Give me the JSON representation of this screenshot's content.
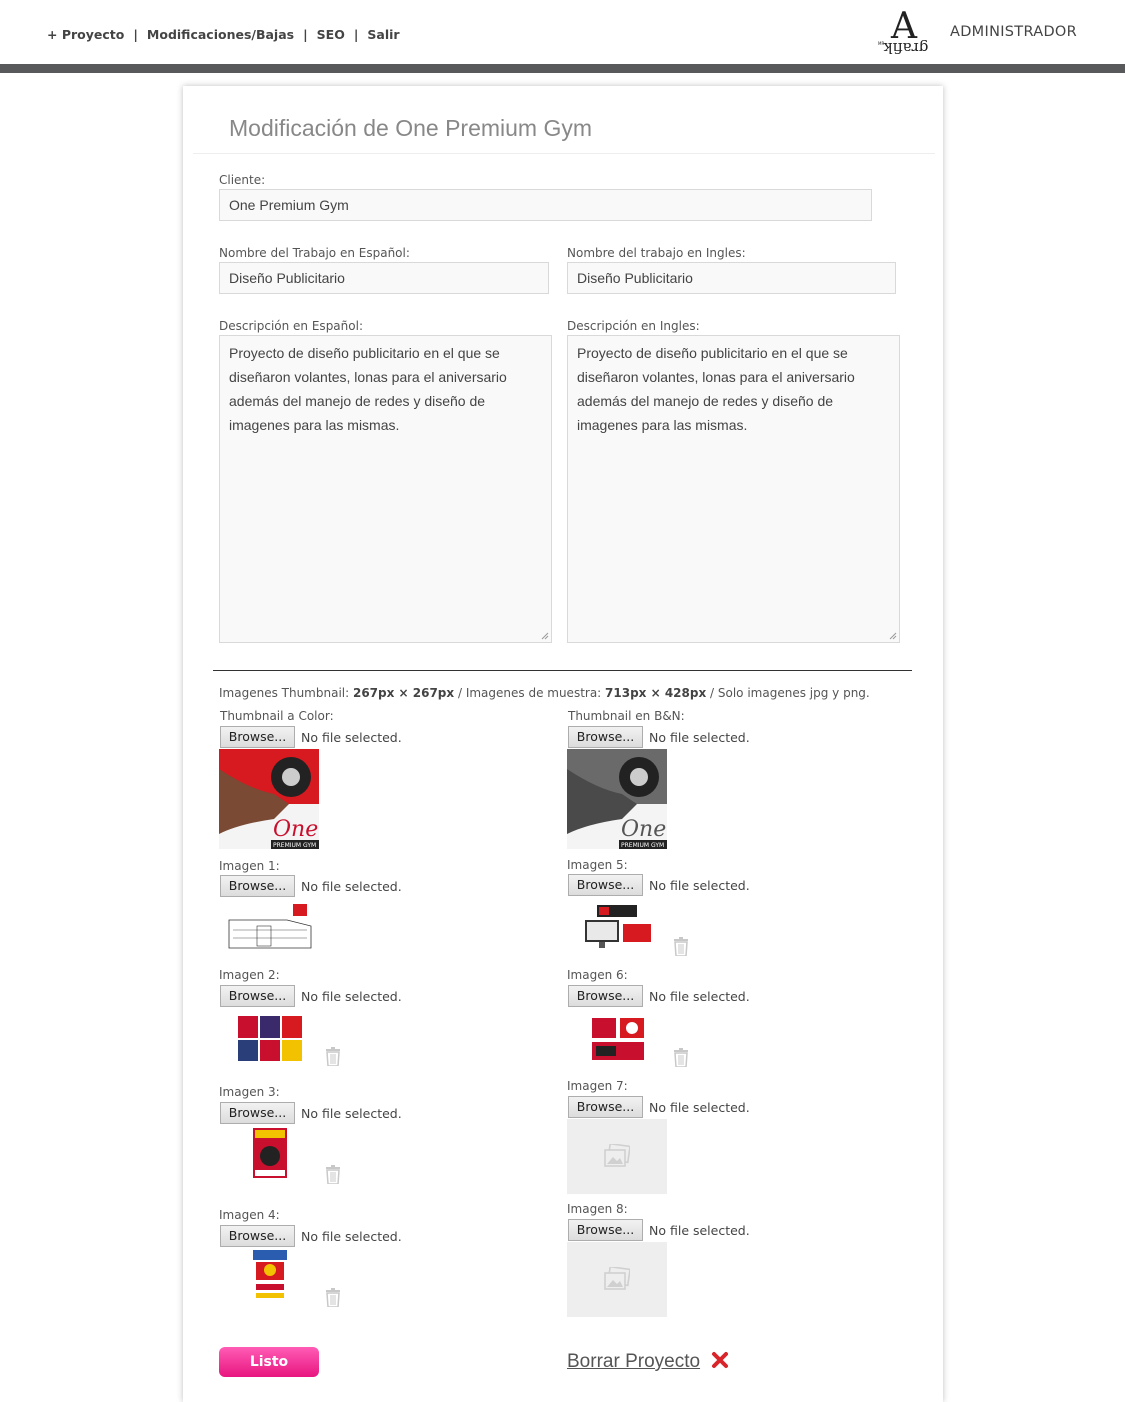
{
  "nav": {
    "items": [
      "+ Proyecto",
      "Modificaciones/Bajas",
      "SEO",
      "Salir"
    ],
    "separator": "|"
  },
  "logo": {
    "letter": "A",
    "word": "grafik",
    "mark": "MR"
  },
  "admin_label": "ADMINISTRADOR",
  "page_title": "Modificación de One Premium Gym",
  "form": {
    "cliente_label": "Cliente:",
    "cliente_value": "One Premium Gym",
    "nombre_es_label": "Nombre del Trabajo en Español:",
    "nombre_es_value": "Diseño Publicitario",
    "nombre_en_label": "Nombre del trabajo en Ingles:",
    "nombre_en_value": "Diseño Publicitario",
    "desc_es_label": "Descripción en Español:",
    "desc_es_value": "Proyecto de diseño publicitario en el que se diseñaron volantes, lonas para el aniversario además del manejo de redes y diseño de imagenes para las mismas.",
    "desc_en_label": "Descripción en Ingles:",
    "desc_en_value": "Proyecto de diseño publicitario en el que se diseñaron volantes, lonas para el aniversario además del manejo de redes y diseño de imagenes para las mismas."
  },
  "images_info": {
    "thumb_label": "Imagenes Thumbnail: ",
    "thumb_size": "267px × 267px",
    "sep1": " / Imagenes de muestra: ",
    "sample_size": "713px × 428px",
    "sep2": " / Solo imagenes jpg y png."
  },
  "browse_label": "Browse...",
  "no_file": "No file selected.",
  "uploads": {
    "thumb_color": "Thumbnail a Color:",
    "thumb_bn": "Thumbnail en B&N:",
    "img1": "Imagen 1:",
    "img2": "Imagen 2:",
    "img3": "Imagen 3:",
    "img4": "Imagen 4:",
    "img5": "Imagen 5:",
    "img6": "Imagen 6:",
    "img7": "Imagen 7:",
    "img8": "Imagen 8:"
  },
  "thumb_text": {
    "brand": "One",
    "sub": "PREMIUM GYM"
  },
  "icons": [
    "trash-icon",
    "image-placeholder-icon",
    "close-x-icon",
    "resize-grip-icon"
  ],
  "colors": {
    "accent_pink": "#e8157f",
    "delete_red": "#d9252a",
    "band_gray": "#58595b"
  },
  "actions": {
    "listo": "Listo",
    "borrar": "Borrar Proyecto"
  }
}
